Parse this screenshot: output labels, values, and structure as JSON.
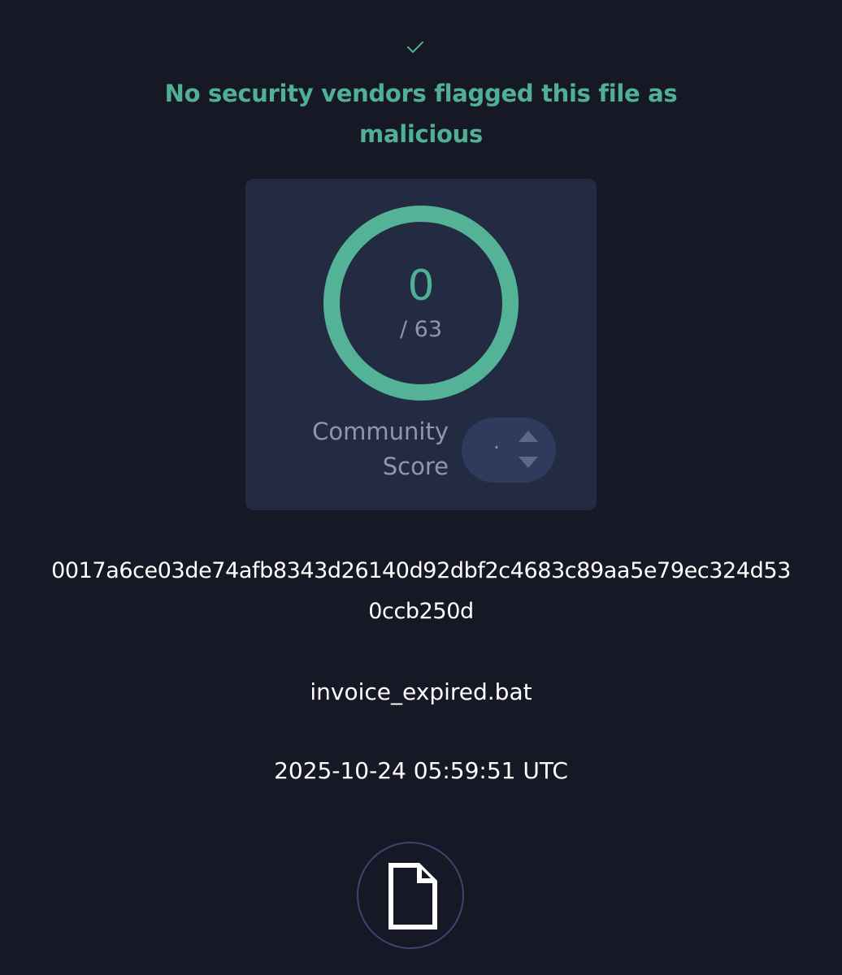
{
  "verdict": {
    "icon": "check-icon",
    "title": "No security vendors flagged this file as malicious",
    "accent_color": "#4fb093"
  },
  "score": {
    "detections": "0",
    "total": "/ 63",
    "community_label": "Community Score",
    "community_value": "·"
  },
  "file": {
    "hash": "0017a6ce03de74afb8343d26140d92dbf2c4683c89aa5e79ec324d530ccb250d",
    "name": "invoice_expired.bat",
    "scan_date": "2025-10-24 05:59:51 UTC",
    "type_icon": "file-icon"
  },
  "colors": {
    "background": "#171825",
    "card": "#232b42",
    "muted_text": "#8d97ad",
    "pill": "#2f3b5c"
  }
}
